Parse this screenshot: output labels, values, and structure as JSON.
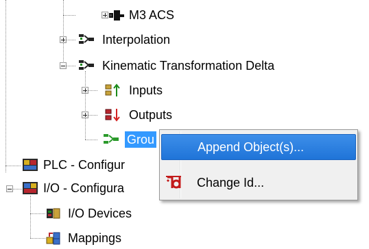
{
  "tree": {
    "m3_acs": "M3 ACS",
    "interpolation": "Interpolation",
    "kinematic_delta": "Kinematic Transformation Delta",
    "inputs": "Inputs",
    "outputs": "Outputs",
    "groups": "Grou",
    "plc": "PLC - Configur",
    "io_config": "I/O - Configura",
    "io_devices": "I/O Devices",
    "mappings": "Mappings"
  },
  "context_menu": {
    "append": "Append Object(s)...",
    "change_id": "Change Id..."
  },
  "icons": {
    "append": "none",
    "change_id": "change-id-icon"
  },
  "colors": {
    "selection": "#3399ff",
    "menu_hover": "#2f84e4",
    "menu_background": "#f0f0f0"
  }
}
